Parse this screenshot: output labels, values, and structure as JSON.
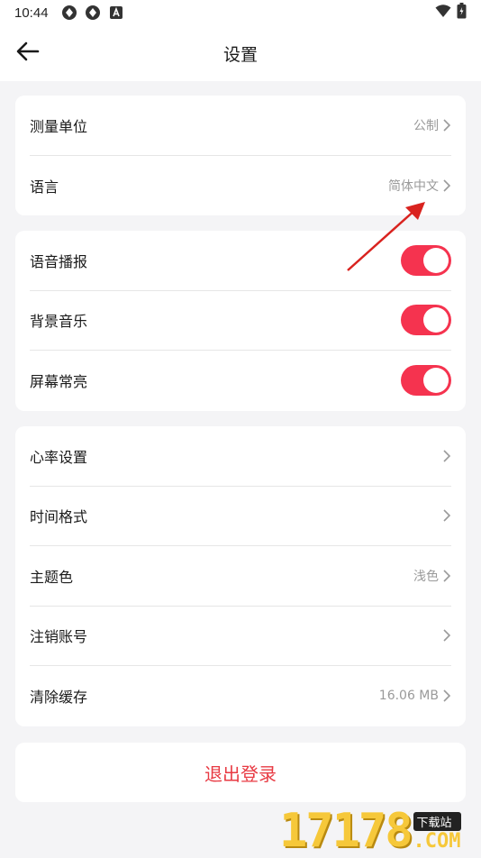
{
  "status_bar": {
    "time": "10:44",
    "left_icons": [
      "sync-icon",
      "sync-icon",
      "notification-a-icon"
    ],
    "right_icons": [
      "wifi-icon",
      "battery-icon"
    ]
  },
  "header": {
    "title": "设置",
    "back_icon": "back-arrow-icon"
  },
  "group1": {
    "items": [
      {
        "label": "测量单位",
        "value": "公制"
      },
      {
        "label": "语言",
        "value": "简体中文"
      }
    ]
  },
  "group2": {
    "items": [
      {
        "label": "语音播报",
        "on": true
      },
      {
        "label": "背景音乐",
        "on": true
      },
      {
        "label": "屏幕常亮",
        "on": true
      }
    ]
  },
  "group3": {
    "items": [
      {
        "label": "心率设置",
        "value": ""
      },
      {
        "label": "时间格式",
        "value": ""
      },
      {
        "label": "主题色",
        "value": "浅色"
      },
      {
        "label": "注销账号",
        "value": ""
      },
      {
        "label": "清除缓存",
        "value": "16.06 MB"
      }
    ]
  },
  "logout": {
    "label": "退出登录"
  },
  "watermark": {
    "number": "17178",
    "tag": "下载站",
    "suffix": ".COM"
  },
  "colors": {
    "accent": "#f5334f",
    "logout_text": "#e83a43",
    "background": "#f4f4f6",
    "secondary_text": "#9a9a9a",
    "annotation_arrow": "#d9231f"
  }
}
